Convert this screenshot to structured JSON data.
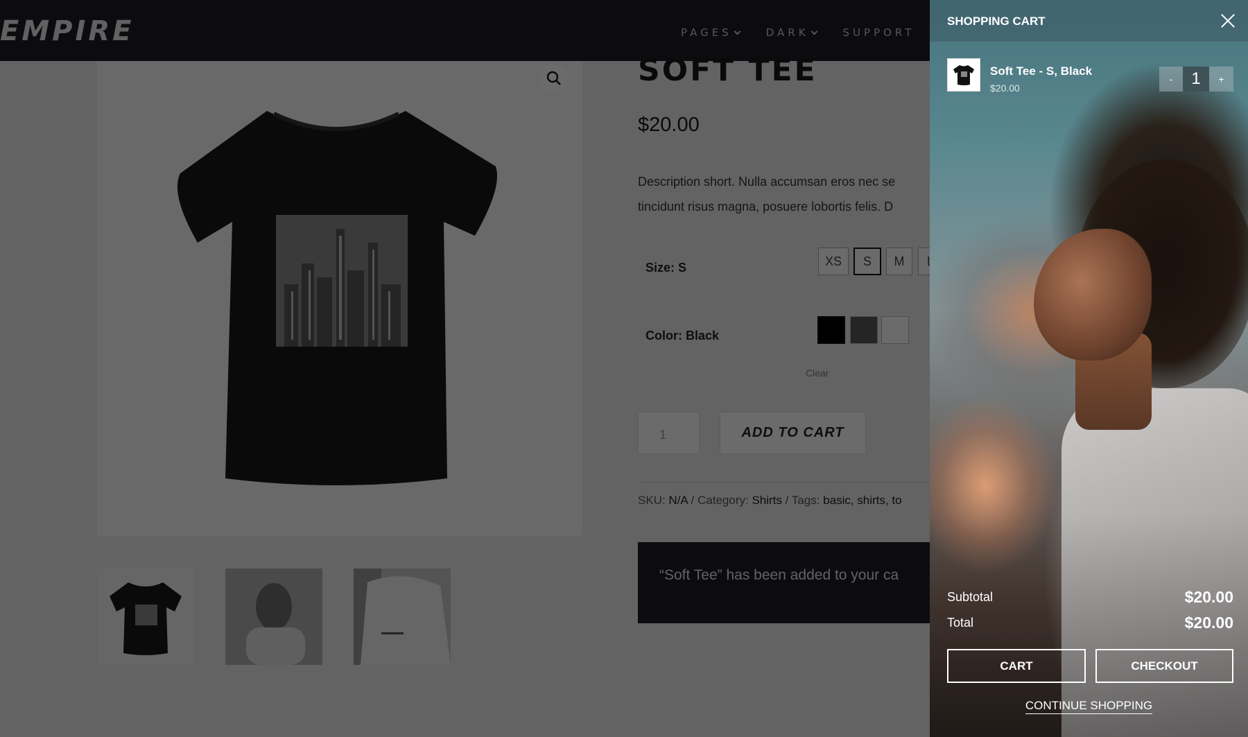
{
  "site": {
    "logo": "EMPIRE",
    "nav": [
      {
        "label": "PAGES"
      },
      {
        "label": "DARK"
      },
      {
        "label": "SUPPORT"
      }
    ]
  },
  "product": {
    "title": "SOFT TEE",
    "price": "$20.00",
    "description_line1": "Description short. Nulla accumsan eros nec se",
    "description_line2": "tincidunt risus magna, posuere lobortis felis. D",
    "size_label": "Size: S",
    "sizes": [
      "XS",
      "S",
      "M",
      "L"
    ],
    "selected_size": "S",
    "color_label": "Color: Black",
    "colors": [
      "#000000",
      "#5a5a5a",
      "#ffffff"
    ],
    "clear_label": "Clear",
    "quantity": "1",
    "add_to_cart_label": "ADD TO CART",
    "meta": {
      "sku_label": "SKU:",
      "sku_value": "N/A",
      "category_label": "Category:",
      "category_value": "Shirts",
      "tags_label": "Tags:",
      "tags_value": "basic, shirts, to"
    },
    "notice": "“Soft Tee” has been added to your ca"
  },
  "cart": {
    "title": "SHOPPING CART",
    "item": {
      "name": "Soft Tee - S, Black",
      "price": "$20.00",
      "qty_minus": "-",
      "qty": "1",
      "qty_plus": "+"
    },
    "subtotal_label": "Subtotal",
    "subtotal_value": "$20.00",
    "total_label": "Total",
    "total_value": "$20.00",
    "cart_button": "CART",
    "checkout_button": "CHECKOUT",
    "continue_label": "CONTINUE SHOPPING"
  }
}
